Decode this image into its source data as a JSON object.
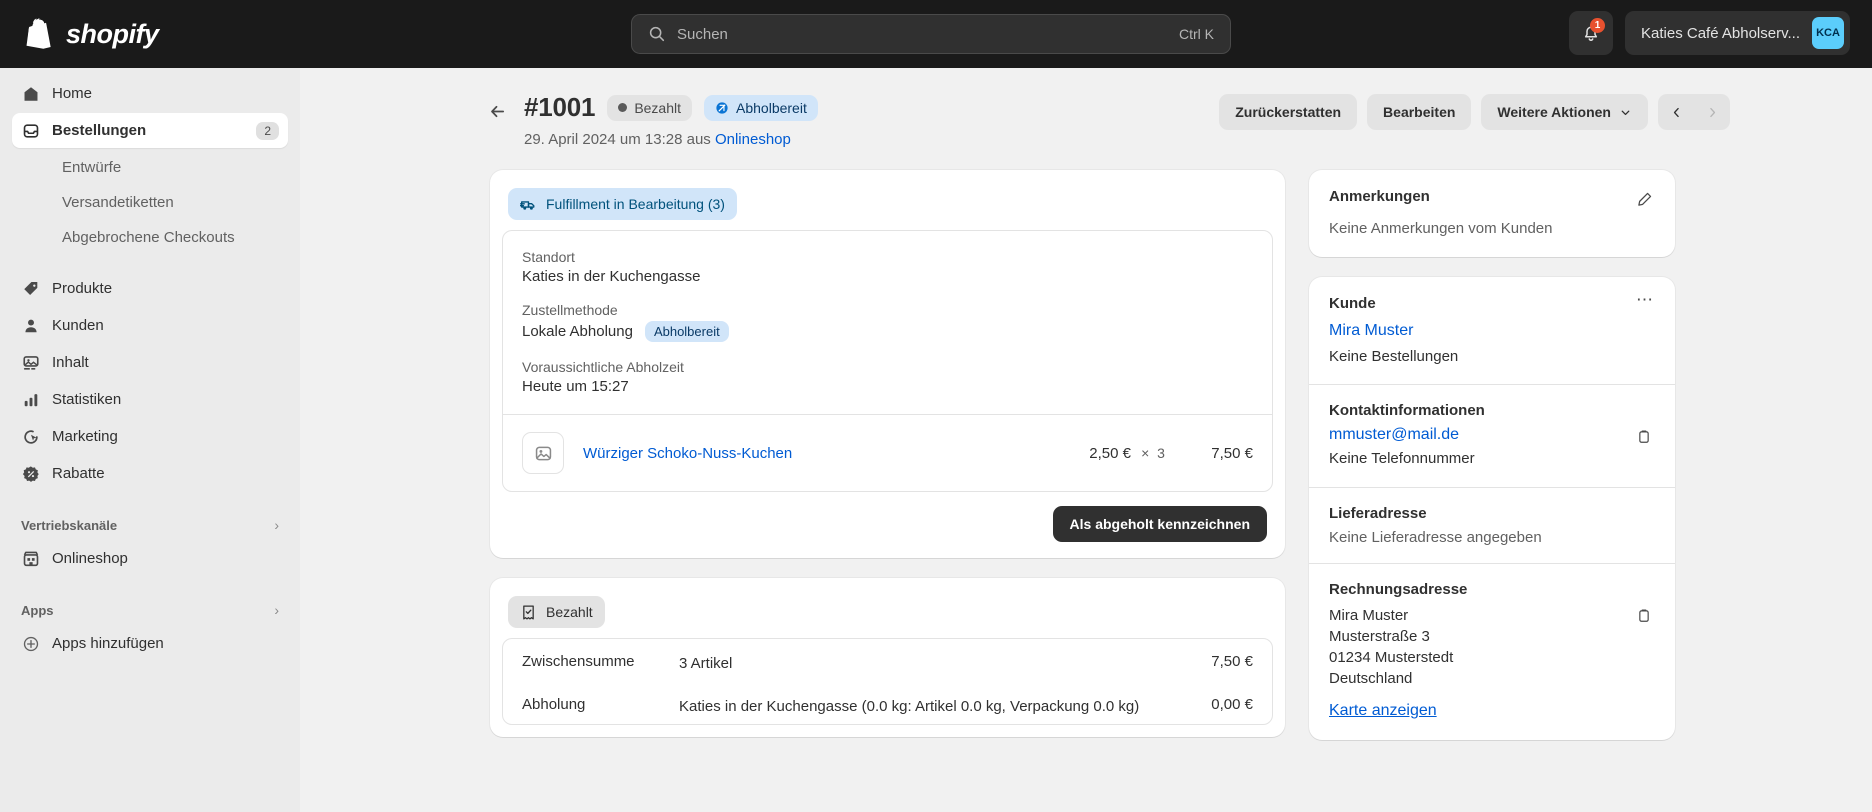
{
  "topbar": {
    "brand": "shopify",
    "search": {
      "placeholder": "Suchen",
      "shortcut": "Ctrl K",
      "icon": "search-icon"
    },
    "notifications": {
      "icon": "bell-icon",
      "count": "1"
    },
    "store": {
      "name": "Katies Café Abholserv...",
      "initials": "KCA"
    }
  },
  "sidebar": {
    "items": [
      {
        "label": "Home",
        "icon": "home-icon",
        "active": false
      },
      {
        "label": "Bestellungen",
        "icon": "orders-inbox-icon",
        "active": true,
        "badge": "2"
      },
      {
        "label": "Produkte",
        "icon": "tag-icon",
        "active": false
      },
      {
        "label": "Kunden",
        "icon": "person-icon",
        "active": false
      },
      {
        "label": "Inhalt",
        "icon": "content-image-icon",
        "active": false
      },
      {
        "label": "Statistiken",
        "icon": "bar-chart-icon",
        "active": false
      },
      {
        "label": "Marketing",
        "icon": "marketing-target-icon",
        "active": false
      },
      {
        "label": "Rabatte",
        "icon": "discount-percent-icon",
        "active": false
      }
    ],
    "sub_items": [
      "Entwürfe",
      "Versandetiketten",
      "Abgebrochene Checkouts"
    ],
    "sections": {
      "channels_label": "Vertriebskanäle",
      "channels_item": "Onlineshop",
      "channels_icon": "store-icon",
      "apps_label": "Apps",
      "apps_item": "Apps hinzufügen",
      "apps_icon": "plus-circle-icon"
    }
  },
  "page": {
    "back_icon": "arrow-left-icon",
    "order_number": "#1001",
    "status_paid": "Bezahlt",
    "status_pickup": "Abholbereit",
    "subtitle_prefix": "29. April 2024 um 13:28 aus ",
    "subtitle_link": "Onlineshop",
    "actions": {
      "refund": "Zurückerstatten",
      "edit": "Bearbeiten",
      "more": "Weitere Aktionen",
      "more_icon": "chevron-down-icon",
      "prev_icon": "chevron-left-icon",
      "next_icon": "chevron-right-icon"
    }
  },
  "fulfillment_card": {
    "chip_label": "Fulfillment in Bearbeitung (3)",
    "chip_icon": "delivery-truck-icon",
    "location_label": "Standort",
    "location_value": "Katies in der Kuchengasse",
    "method_label": "Zustellmethode",
    "method_value": "Lokale Abholung",
    "method_badge": "Abholbereit",
    "pickup_label": "Voraussichtliche Abholzeit",
    "pickup_value": "Heute um 15:27",
    "line_item": {
      "thumb_icon": "image-placeholder-icon",
      "name": "Würziger Schoko-Nuss-Kuchen",
      "unit_price": "2,50 €",
      "times": "×",
      "qty": "3",
      "total": "7,50 €"
    },
    "primary_action": "Als abgeholt kennzeichnen"
  },
  "payment_card": {
    "chip_label": "Bezahlt",
    "chip_icon": "receipt-check-icon",
    "rows": [
      {
        "label": "Zwischensumme",
        "desc": "3 Artikel",
        "amount": "7,50 €"
      },
      {
        "label": "Abholung",
        "desc": "Katies in der Kuchengasse (0.0 kg: Artikel 0.0 kg, Verpackung 0.0 kg)",
        "amount": "0,00 €"
      }
    ]
  },
  "notes_card": {
    "title": "Anmerkungen",
    "edit_icon": "pencil-icon",
    "body": "Keine Anmerkungen vom Kunden"
  },
  "customer_card": {
    "title": "Kunde",
    "menu_icon": "ellipsis-icon",
    "name": "Mira Muster",
    "orders_text": "Keine Bestellungen",
    "contact_title": "Kontaktinformationen",
    "email": "mmuster@mail.de",
    "copy_icon": "clipboard-copy-icon",
    "phone_text": "Keine Telefonnummer",
    "shipping_title": "Lieferadresse",
    "shipping_text": "Keine Lieferadresse angegeben",
    "billing_title": "Rechnungsadresse",
    "billing_lines": [
      "Mira Muster",
      "Musterstraße 3",
      "01234 Musterstedt",
      "Deutschland"
    ],
    "map_link": "Karte anzeigen"
  },
  "colors": {
    "topbar_bg": "#1a1a1a",
    "accent_link": "#005bd3",
    "badge_blue_bg": "#d1e5f9",
    "avatar_bg": "#5bcdfb",
    "notification_bg": "#e8512f"
  }
}
